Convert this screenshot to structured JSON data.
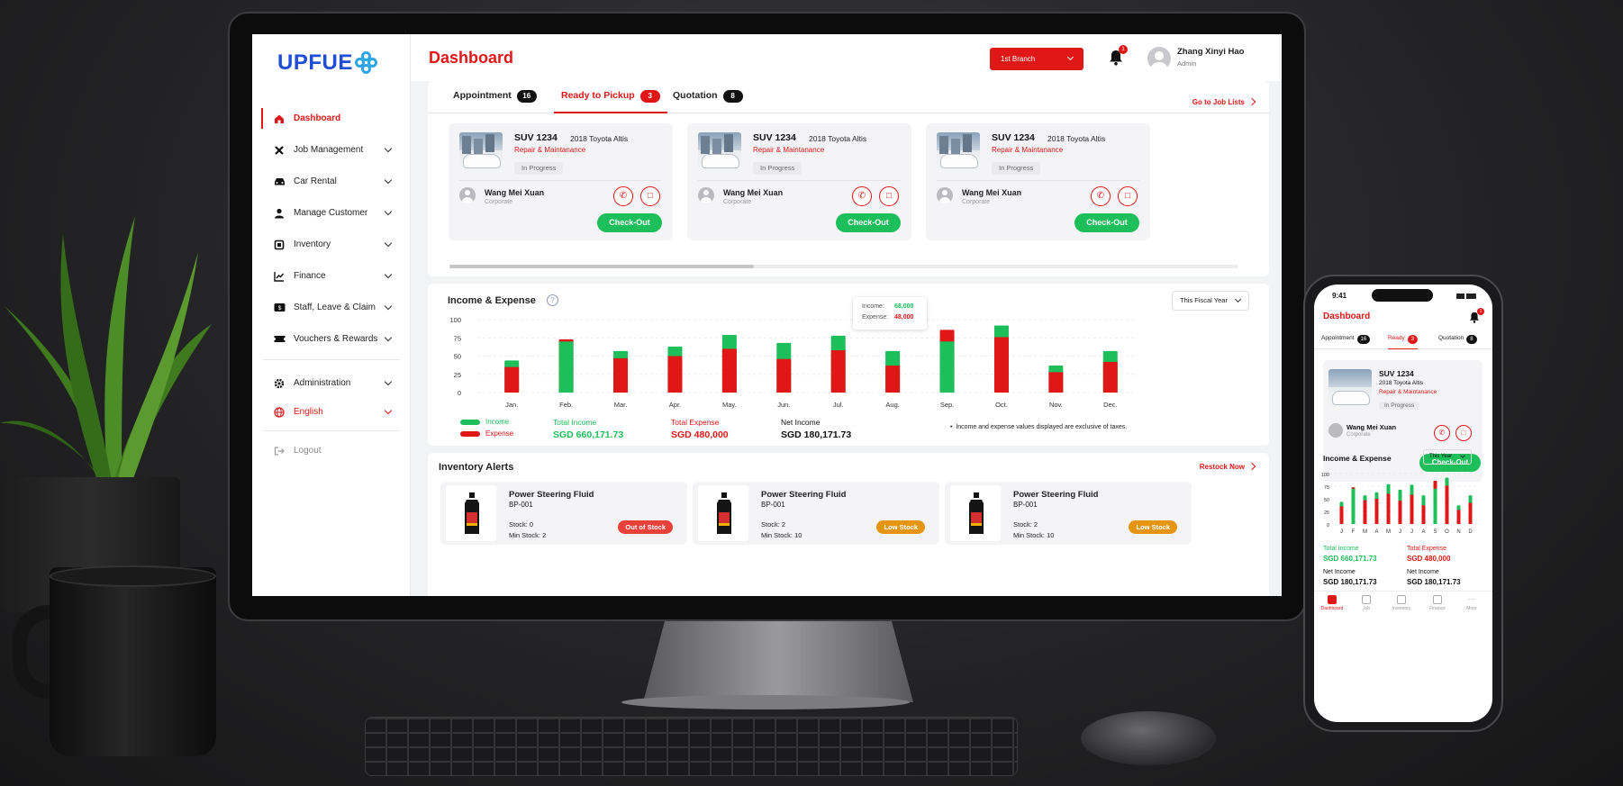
{
  "sidebar": {
    "logo_text": "UPFUE",
    "items": [
      {
        "label": "Dashboard",
        "icon": "home-icon",
        "active": true
      },
      {
        "label": "Job Management",
        "icon": "tools-icon"
      },
      {
        "label": "Car Rental",
        "icon": "car-icon"
      },
      {
        "label": "Manage Customer",
        "icon": "user-icon"
      },
      {
        "label": "Inventory",
        "icon": "box-icon"
      },
      {
        "label": "Finance",
        "icon": "chart-icon"
      },
      {
        "label": "Staff, Leave & Claim",
        "icon": "staff-icon"
      },
      {
        "label": "Vouchers & Rewards",
        "icon": "voucher-icon"
      }
    ],
    "administration": "Administration",
    "language": "English",
    "logout": "Logout"
  },
  "header": {
    "title": "Dashboard",
    "branch": "1st Branch",
    "notification_count": "1",
    "user_name": "Zhang Xinyi Hao",
    "user_role": "Admin"
  },
  "jobs": {
    "tabs": [
      {
        "label": "Appointment",
        "count": "16"
      },
      {
        "label": "Ready to Pickup",
        "count": "3",
        "active": true
      },
      {
        "label": "Quotation",
        "count": "8"
      }
    ],
    "go_link": "Go to Job Lists",
    "cards": [
      {
        "plate": "SUV 1234",
        "model": "2018 Toyota Altis",
        "service": "Repair & Maintanance",
        "status": "In Progress",
        "customer": "Wang Mei Xuan",
        "customer_type": "Corporate",
        "action": "Check-Out"
      },
      {
        "plate": "SUV 1234",
        "model": "2018 Toyota Altis",
        "service": "Repair & Maintanance",
        "status": "In Progress",
        "customer": "Wang Mei Xuan",
        "customer_type": "Corporate",
        "action": "Check-Out"
      },
      {
        "plate": "SUV 1234",
        "model": "2018 Toyota Altis",
        "service": "Repair & Maintanance",
        "status": "In Progress",
        "customer": "Wang Mei Xuan",
        "customer_type": "Corporate",
        "action": "Check-Out"
      }
    ]
  },
  "income_expense": {
    "title": "Income & Expense",
    "period": "This Fiscal Year",
    "tooltip": {
      "income_label": "Income:",
      "income_value": "68,000",
      "expense_label": "Expense:",
      "expense_value": "48,000"
    },
    "legend_income": "Income",
    "legend_expense": "Expense",
    "total_income_label": "Total Income",
    "total_income_value": "SGD 660,171.73",
    "total_expense_label": "Total Expense",
    "total_expense_value": "SGD 480,000",
    "net_income_label": "Net Income",
    "net_income_value": "SGD 180,171.73",
    "footnote": "Income and expense values displayed are exclusive of taxes."
  },
  "chart_data": {
    "type": "bar",
    "categories": [
      "Jan.",
      "Feb.",
      "Mar.",
      "Apr.",
      "May.",
      "Jun.",
      "Jul.",
      "Aug.",
      "Sep.",
      "Oct.",
      "Nov.",
      "Dec."
    ],
    "series": [
      {
        "name": "Income",
        "values": [
          44,
          70,
          57,
          63,
          79,
          68,
          78,
          57,
          70,
          92,
          37,
          57
        ]
      },
      {
        "name": "Expense",
        "values": [
          35,
          73,
          47,
          50,
          60,
          46,
          58,
          37,
          86,
          76,
          28,
          42
        ]
      }
    ],
    "ylim": [
      0,
      100
    ],
    "yticks": [
      "100",
      "75",
      "50",
      "25",
      "0"
    ],
    "colors": {
      "income": "#1cbf5a",
      "expense": "#e01717"
    }
  },
  "inventory": {
    "title": "Inventory Alerts",
    "restock": "Restock Now",
    "items": [
      {
        "name": "Power Steering Fluid",
        "code": "BP-001",
        "stock": "Stock: 0",
        "min_stock": "Min Stock: 2",
        "badge": "Out of Stock",
        "badge_color": "#e8413a"
      },
      {
        "name": "Power Steering Fluid",
        "code": "BP-001",
        "stock": "Stock: 2",
        "min_stock": "Min Stock: 10",
        "badge": "Low Stock",
        "badge_color": "#e69512"
      },
      {
        "name": "Power Steering Fluid",
        "code": "BP-001",
        "stock": "Stock: 2",
        "min_stock": "Min Stock: 10",
        "badge": "Low Stock",
        "badge_color": "#e69512"
      }
    ]
  },
  "phone": {
    "time": "9:41",
    "title": "Dashboard",
    "notification_count": "1",
    "tabs": [
      {
        "label": "Appointment",
        "count": "16"
      },
      {
        "label": "Ready",
        "count": "3"
      },
      {
        "label": "Quotation",
        "count": "8"
      }
    ],
    "card": {
      "plate": "SUV 1234",
      "model": "2018 Toyota Altis",
      "service": "Repair & Maintanance",
      "status": "In Progress",
      "customer": "Wang Mei Xuan",
      "customer_type": "Corporate",
      "action": "Check-Out"
    },
    "ie_title": "Income & Expense",
    "period": "This Year",
    "yticks": [
      "100",
      "75",
      "50",
      "25",
      "0"
    ],
    "months": [
      "J",
      "F",
      "M",
      "A",
      "M",
      "J",
      "J",
      "A",
      "S",
      "O",
      "N",
      "D"
    ],
    "total_income_label": "Total Income",
    "total_income_value": "SGD 660,171.73",
    "total_expense_label": "Total Expense",
    "total_expense_value": "SGD 480,000",
    "net_income_label": "Net Income",
    "net_income_value": "SGD 180,171.73",
    "net_income_label_2": "Net Income",
    "net_income_value_2": "SGD 180,171.73",
    "nav": [
      "Dashboard",
      "Job",
      "Inventory",
      "Finance",
      "More"
    ]
  }
}
